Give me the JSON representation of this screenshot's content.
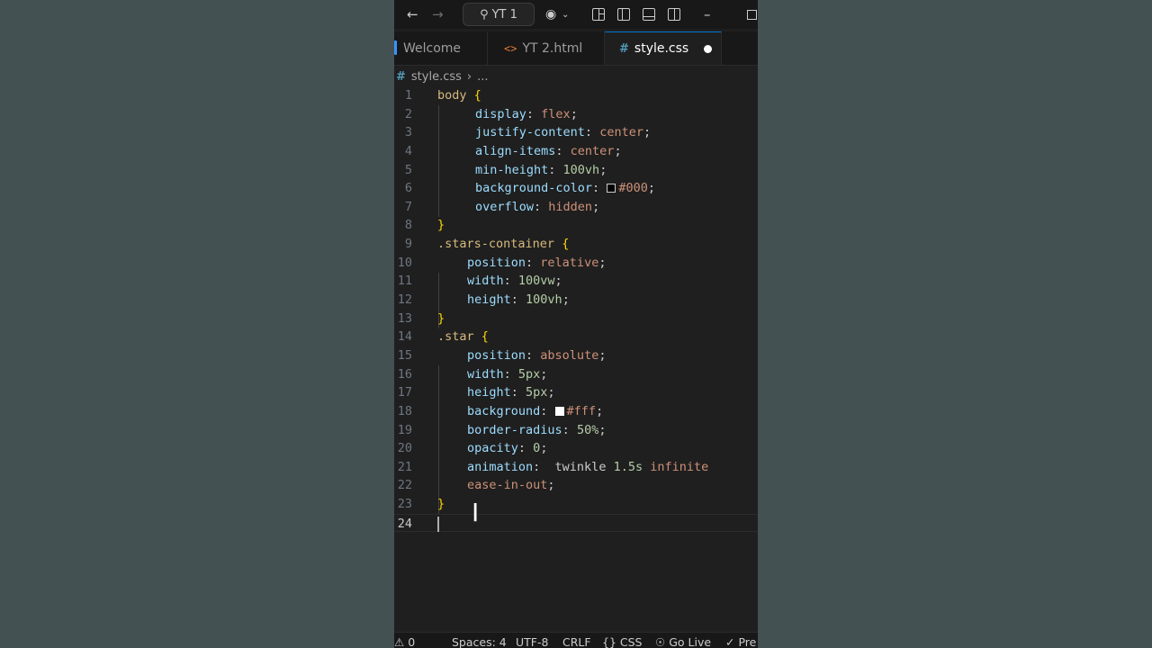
{
  "titlebar": {
    "back_icon": "arrow-left-icon",
    "forward_icon": "arrow-right-icon",
    "search_label": "YT 1",
    "search_icon": "search-icon",
    "copilot_icon": "copilot-icon"
  },
  "tabs": [
    {
      "label": "Welcome",
      "icon": "",
      "active": false
    },
    {
      "label": "YT 2.html",
      "icon": "<>",
      "active": false
    },
    {
      "label": "style.css",
      "icon": "#",
      "active": true,
      "dirty": true
    }
  ],
  "breadcrumb": {
    "file": "style.css",
    "ellipsis": "..."
  },
  "code": {
    "line_numbers": [
      "1",
      "2",
      "3",
      "4",
      "5",
      "6",
      "7",
      "8",
      "9",
      "10",
      "11",
      "12",
      "13",
      "14",
      "15",
      "16",
      "17",
      "18",
      "19",
      "20",
      "21",
      "22",
      "23",
      "24"
    ],
    "l1_sel": "body",
    "l1_brace": "{",
    "l2_prop": "display",
    "l2_val": "flex",
    "l3_prop": "justify-content",
    "l3_val": "center",
    "l4_prop": "align-items",
    "l4_val": "center",
    "l5_prop": "min-height",
    "l5_val": "100vh",
    "l6_prop": "background-color",
    "l6_val": "#000",
    "l7_prop": "overflow",
    "l7_val": "hidden",
    "l8_brace": "}",
    "l9_sel": ".stars-container",
    "l9_brace": "{",
    "l10_prop": "position",
    "l10_val": "relative",
    "l11_prop": "width",
    "l11_val": "100vw",
    "l12_prop": "height",
    "l12_val": "100vh",
    "l13_brace": "}",
    "l14_sel": ".star",
    "l14_brace": "{",
    "l15_prop": "position",
    "l15_val": "absolute",
    "l16_prop": "width",
    "l16_val": "5px",
    "l17_prop": "height",
    "l17_val": "5px",
    "l18_prop": "background",
    "l18_val": "#fff",
    "l19_prop": "border-radius",
    "l19_val": "50%",
    "l20_prop": "opacity",
    "l20_val": "0",
    "l21_prop": "animation",
    "l21_val_a": "twinkle",
    "l21_val_b": "1.5s",
    "l21_val_c": "infinite",
    "l22_val": "ease-in-out",
    "l23_brace": "}"
  },
  "colors": {
    "swatch_black": "#000000",
    "swatch_white": "#ffffff"
  },
  "statusbar": {
    "problems": "0",
    "spaces": "Spaces: 4",
    "encoding": "UTF-8",
    "eol": "CRLF",
    "language": "CSS",
    "golive": "Go Live",
    "prettier": "Pre"
  }
}
